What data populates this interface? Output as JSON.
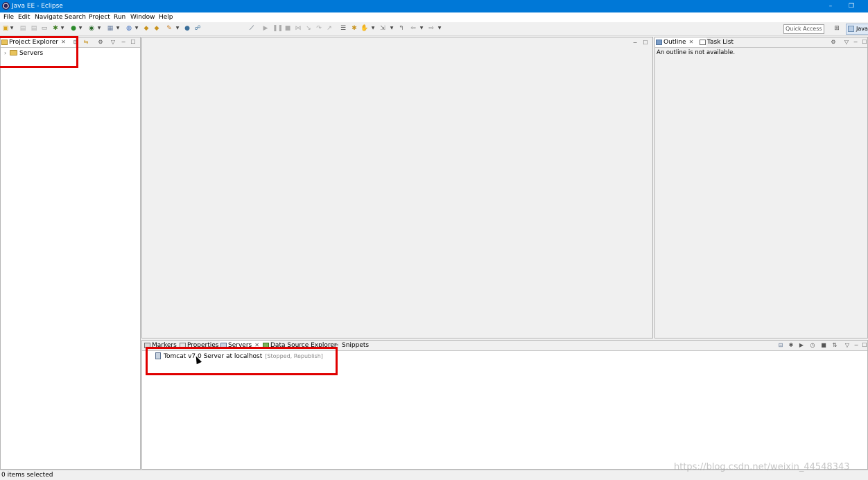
{
  "window": {
    "title": "Java EE - Eclipse",
    "minimize_glyph": "–",
    "restore_glyph": "❐"
  },
  "menu": [
    "File",
    "Edit",
    "Navigate",
    "Search",
    "Project",
    "Run",
    "Window",
    "Help"
  ],
  "toolbar": {
    "quick_access_placeholder": "Quick Access",
    "perspective_label": "Java"
  },
  "project_explorer": {
    "tab_label": "Project Explorer",
    "close_glyph": "✕",
    "tree": [
      {
        "label": "Servers",
        "expander": "›"
      }
    ]
  },
  "outline": {
    "tabs": [
      "Outline",
      "Task List"
    ],
    "message": "An outline is not available."
  },
  "bottom_panel": {
    "tabs": [
      "Markers",
      "Properties",
      "Servers",
      "Data Source Explorer",
      "Snippets"
    ],
    "active_tab": "Servers",
    "servers": [
      {
        "name": "Tomcat v7.0 Server at localhost",
        "state": "[Stopped, Republish]"
      }
    ]
  },
  "status_bar": {
    "text": "0 items selected"
  },
  "watermark": "https://blog.csdn.net/weixin_44548343",
  "colors": {
    "title_bar": "#0078d7",
    "highlight": "#e00000",
    "panel_background": "#f0f0f0"
  },
  "icons": {
    "app": "eclipse-icon",
    "folder": "folder-icon",
    "server": "server-icon"
  }
}
